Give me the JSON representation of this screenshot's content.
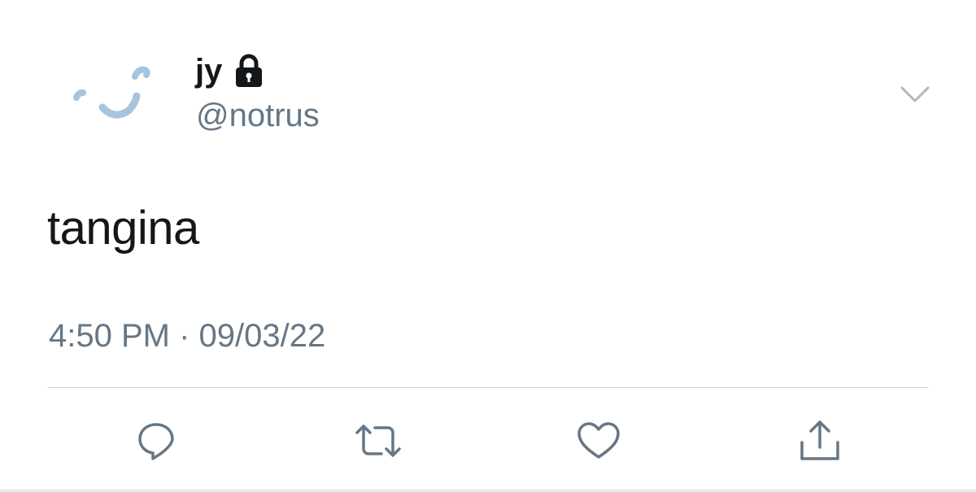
{
  "tweet": {
    "author": {
      "display_name": "jy",
      "handle": "@notrus",
      "protected_icon": "lock-icon",
      "avatar_icon": "smiley-face-avatar"
    },
    "text": "tangina",
    "timestamp": "4:50 PM · 09/03/22",
    "menu_icon": "chevron-down-icon"
  },
  "actions": [
    {
      "name": "reply",
      "icon": "comment-icon"
    },
    {
      "name": "retweet",
      "icon": "retweet-icon"
    },
    {
      "name": "like",
      "icon": "heart-icon"
    },
    {
      "name": "share",
      "icon": "share-icon"
    }
  ],
  "colors": {
    "text_primary": "#14171a",
    "text_secondary": "#657786",
    "icon_gray": "#657786",
    "avatar_blue": "#a8c4dd",
    "divider": "#ccd6dd"
  }
}
